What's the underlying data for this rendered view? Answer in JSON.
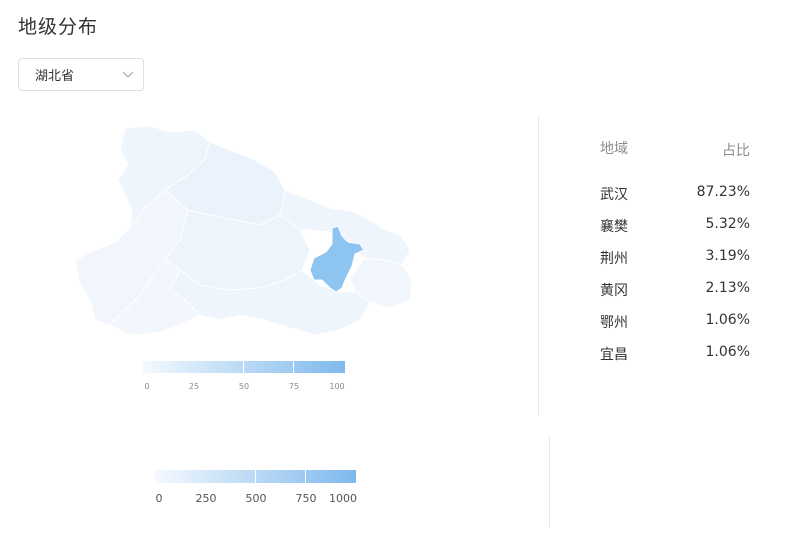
{
  "page": {
    "title": "地级分布"
  },
  "province_select": {
    "value": "湖北省",
    "icon": "chevron-down-icon"
  },
  "map": {
    "highlight_color": "#8ec4f0",
    "base_color": "#eef5fc",
    "legend": {
      "labels": [
        "0",
        "25",
        "50",
        "75",
        "100"
      ]
    }
  },
  "lower_legend": {
    "labels": [
      "0",
      "250",
      "500",
      "750",
      "1000"
    ]
  },
  "table": {
    "headers": {
      "region": "地域",
      "share": "占比"
    },
    "rows": [
      {
        "region": "武汉",
        "share": "87.23%"
      },
      {
        "region": "襄樊",
        "share": "5.32%"
      },
      {
        "region": "荆州",
        "share": "3.19%"
      },
      {
        "region": "黄冈",
        "share": "2.13%"
      },
      {
        "region": "鄂州",
        "share": "1.06%"
      },
      {
        "region": "宜昌",
        "share": "1.06%"
      }
    ]
  }
}
